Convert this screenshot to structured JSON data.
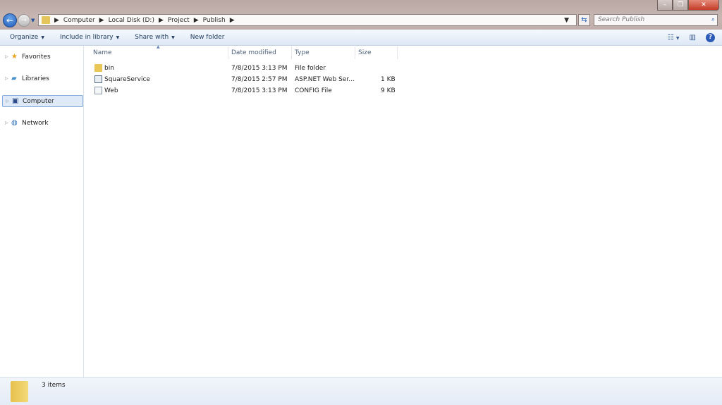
{
  "address": {
    "crumbs": [
      "Computer",
      "Local Disk (D:)",
      "Project",
      "Publish"
    ]
  },
  "search": {
    "placeholder": "Search Publish"
  },
  "toolbar": {
    "organize": "Organize",
    "include": "Include in library",
    "share": "Share with",
    "new_folder": "New folder"
  },
  "sidebar": {
    "items": [
      {
        "label": "Favorites"
      },
      {
        "label": "Libraries"
      },
      {
        "label": "Computer"
      },
      {
        "label": "Network"
      }
    ]
  },
  "columns": {
    "name": "Name",
    "date": "Date modified",
    "type": "Type",
    "size": "Size"
  },
  "files": [
    {
      "name": "bin",
      "date": "7/8/2015 3:13 PM",
      "type": "File folder",
      "size": ""
    },
    {
      "name": "SquareService",
      "date": "7/8/2015 2:57 PM",
      "type": "ASP.NET Web Ser...",
      "size": "1 KB"
    },
    {
      "name": "Web",
      "date": "7/8/2015 3:13 PM",
      "type": "CONFIG File",
      "size": "9 KB"
    }
  ],
  "status": {
    "count": "3 items"
  }
}
